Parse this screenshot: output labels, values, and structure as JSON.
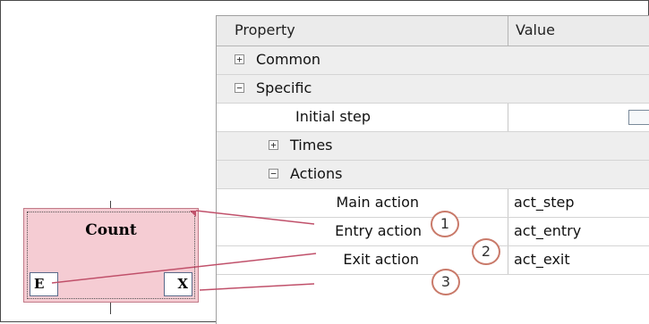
{
  "grid": {
    "header": {
      "property": "Property",
      "value": "Value"
    },
    "rows": [
      {
        "expander": "+",
        "label": "Common"
      },
      {
        "expander": "−",
        "label": "Specific"
      },
      {
        "label": "Initial step",
        "value": ""
      },
      {
        "expander": "+",
        "label": "Times"
      },
      {
        "expander": "−",
        "label": "Actions"
      },
      {
        "label": "Main action",
        "value": "act_step"
      },
      {
        "label": "Entry action",
        "value": "act_entry"
      },
      {
        "label": "Exit action",
        "value": "act_exit"
      }
    ]
  },
  "step": {
    "title": "Count",
    "entry_box": "E",
    "exit_box": "X"
  },
  "callouts": [
    "1",
    "2",
    "3"
  ],
  "colors": {
    "step_fill": "#f5ccd3",
    "callout_ring": "#c97a6a",
    "connector": "#c0506a"
  }
}
